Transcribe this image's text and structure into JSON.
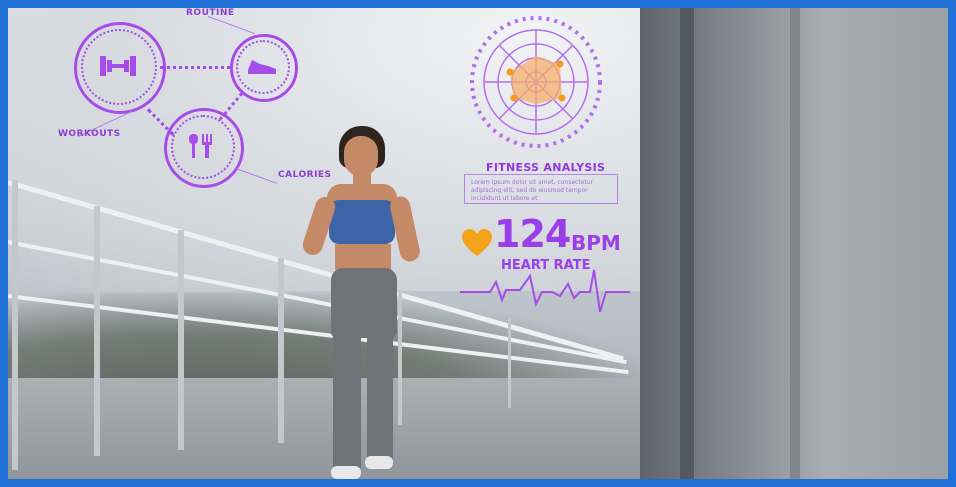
{
  "hud": {
    "top_label": "ROUTINE",
    "left_label": "WORKOUTS",
    "right_label": "CALORIES",
    "fitness_title": "FITNESS ANALYSIS",
    "fitness_text": "Lorem ipsum dolor sit amet, consectetur adipiscing elit, sed do eiusmod tempor incididunt ut labore et",
    "bpm_value": "124",
    "bpm_unit": "BPM",
    "heart_rate_label": "HEART RATE"
  },
  "icons": [
    "dumbbell-icon",
    "sneaker-icon",
    "fork-knife-icon",
    "heart-icon",
    "radar-chart-icon",
    "pulse-line-icon"
  ],
  "colors": {
    "hud_purple": "#9a3ee8",
    "heart_orange": "#f5a21b",
    "frame_blue": "#1e6fd6"
  }
}
